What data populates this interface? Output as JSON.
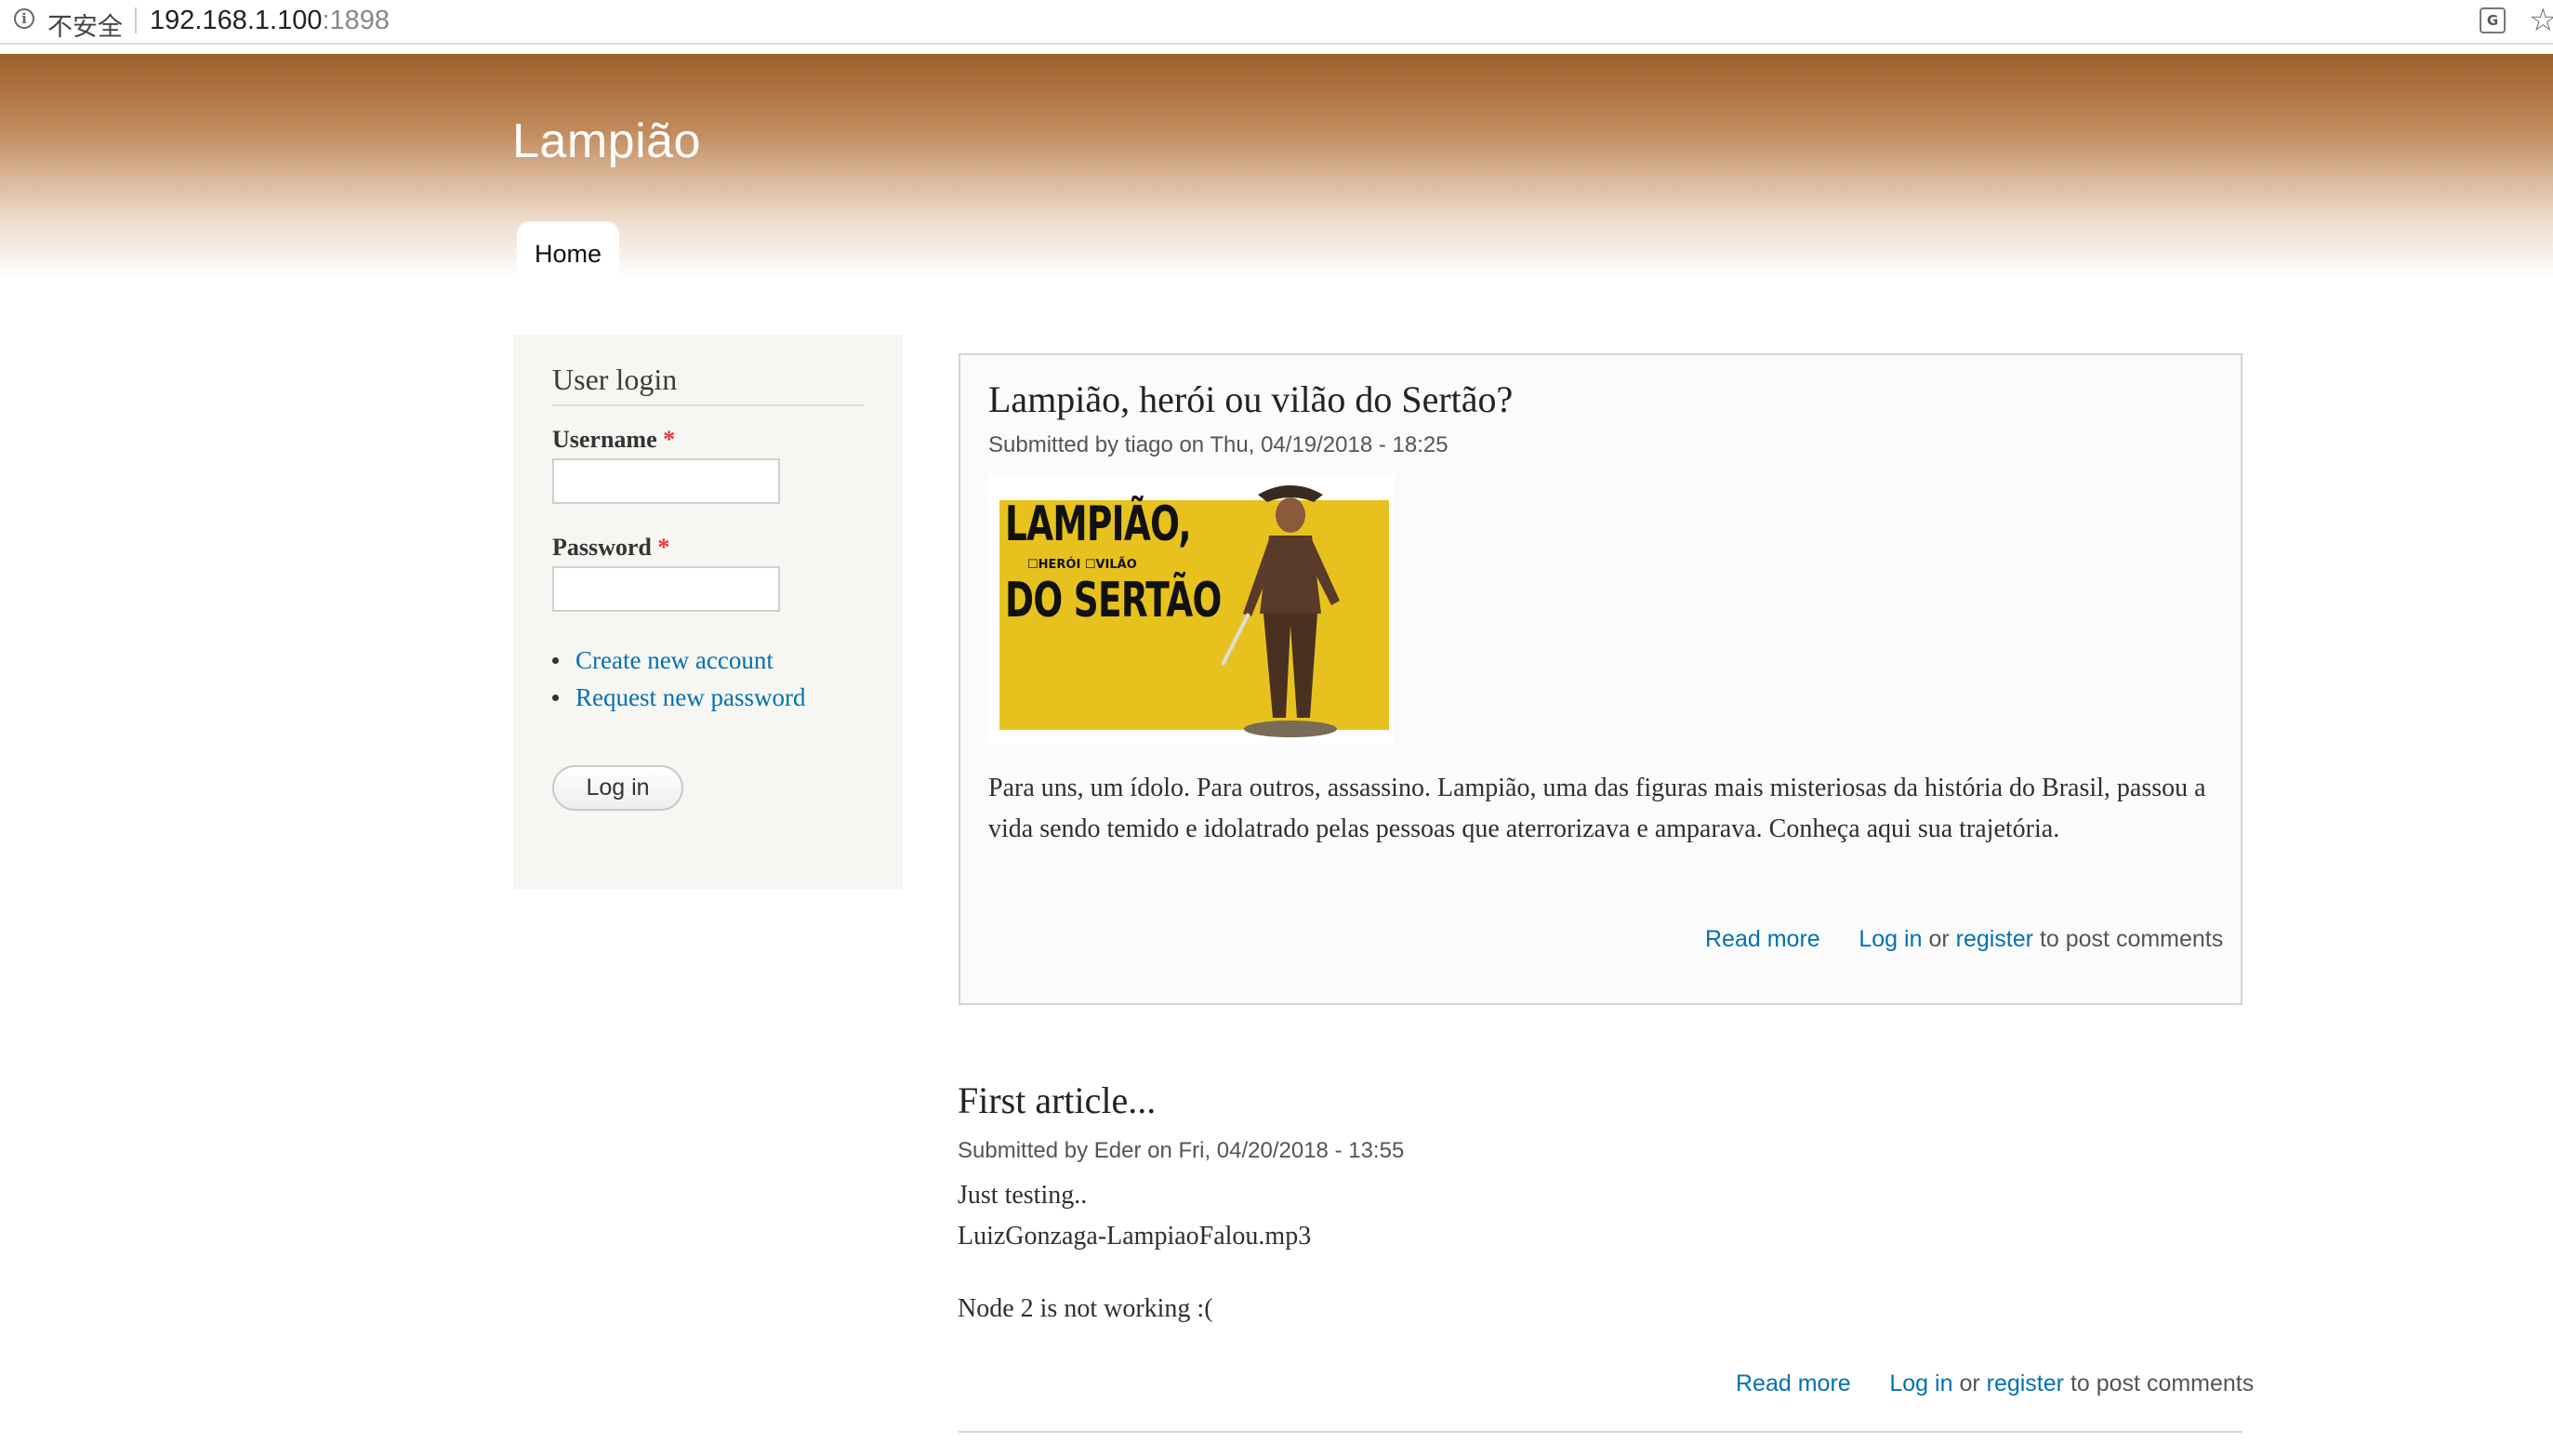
{
  "browser": {
    "security_label": "不安全",
    "url_host": "192.168.1.100",
    "url_port": ":1898"
  },
  "header": {
    "site_name": "Lampião",
    "nav_home": "Home"
  },
  "login_block": {
    "title": "User login",
    "username_label": "Username",
    "password_label": "Password",
    "required_marker": "*",
    "username_value": "",
    "password_value": "",
    "links": [
      "Create new account",
      "Request new password"
    ],
    "login_button": "Log in"
  },
  "articles": [
    {
      "title": "Lampião, herói ou vilão do Sertão?",
      "meta": "Submitted by tiago on Thu, 04/19/2018 - 18:25",
      "image_text": {
        "line1": "LAMPIÃO,",
        "options": "☐HERÓI  ☐VILÃO",
        "line2": "DO SERTÃO"
      },
      "body": "Para uns, um ídolo. Para outros, assassino. Lampião, uma das figuras mais misteriosas da história do Brasil, passou a vida sendo temido e idolatrado pelas pessoas que aterrorizava e amparava. Conheça aqui sua trajetória.",
      "read_more": "Read more",
      "login_link": "Log in",
      "or": "or",
      "register_link": "register",
      "suffix": "to post comments"
    },
    {
      "title": "First article...",
      "meta": "Submitted by Eder on Fri, 04/20/2018 - 13:55",
      "line1": "Just testing..",
      "line2": "LuizGonzaga-LampiaoFalou.mp3",
      "line3": "Node 2 is not working :(",
      "read_more": "Read more",
      "login_link": "Log in",
      "or": "or",
      "register_link": "register",
      "suffix": "to post comments"
    }
  ]
}
